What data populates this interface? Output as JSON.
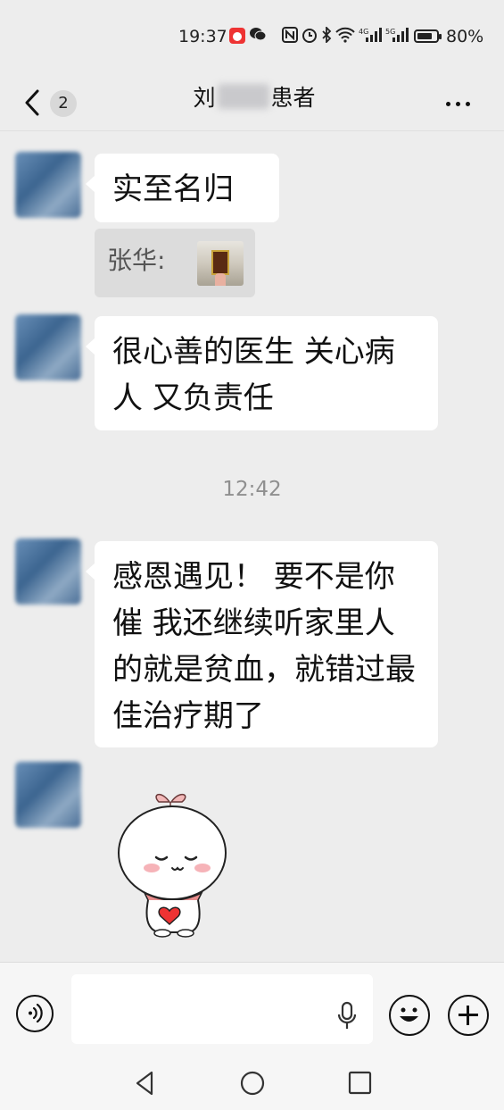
{
  "status_bar": {
    "time": "19:37",
    "network_4g": "4G",
    "network_5g": "5G",
    "battery_percent": "80%",
    "battery_level": 0.8
  },
  "header": {
    "back_count": "2",
    "title_prefix": "刘",
    "title_suffix": "患者"
  },
  "messages": [
    {
      "text": "实至名归"
    },
    {
      "text": "很心善的医生 关心病人 又负责任"
    },
    {
      "text": "感恩遇见！ 要不是你催 我还继续听家里人的就是贫血，就错过最佳治疗期了"
    }
  ],
  "quote": {
    "sender": "张华:"
  },
  "time_divider": "12:42",
  "input": {
    "placeholder": ""
  },
  "colors": {
    "background": "#ededed",
    "bubble": "#ffffff",
    "quote_bg": "#dcdcdc",
    "timestamp": "#8f8f8f"
  },
  "icons": [
    "back-chevron-icon",
    "more-dots-icon",
    "voice-icon",
    "microphone-icon",
    "emoji-icon",
    "plus-icon",
    "nav-back-icon",
    "nav-home-icon",
    "nav-recent-icon",
    "battery-icon",
    "wifi-icon",
    "bluetooth-icon",
    "signal-icon"
  ]
}
